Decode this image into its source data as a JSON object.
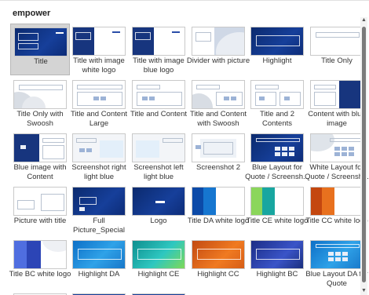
{
  "gallery": {
    "header": "empower",
    "rows": [
      [
        {
          "label": "Title",
          "theme": "dark",
          "selected": true
        },
        {
          "label": "Title with image white logo",
          "theme": "white-img"
        },
        {
          "label": "Title with image blue logo",
          "theme": "white-img"
        },
        {
          "label": "Divider with picture",
          "theme": "divider"
        },
        {
          "label": "Highlight",
          "theme": "dark-hl"
        },
        {
          "label": "Title Only",
          "theme": "white-title"
        }
      ],
      [
        {
          "label": "Title Only with Swoosh",
          "theme": "swoosh"
        },
        {
          "label": "Title and Content Large",
          "theme": "content-large"
        },
        {
          "label": "Title and Content",
          "theme": "content"
        },
        {
          "label": "Title and Content with Swoosh",
          "theme": "content-swoosh"
        },
        {
          "label": "Title and 2 Contents",
          "theme": "two-content"
        },
        {
          "label": "Content with blue image",
          "theme": "content-blue"
        }
      ],
      [
        {
          "label": "Blue image with Content",
          "theme": "blue-content"
        },
        {
          "label": "Screenshot right light blue",
          "theme": "shot-right"
        },
        {
          "label": "Screenshot left light blue",
          "theme": "shot-left"
        },
        {
          "label": "Screenshot 2",
          "theme": "shot2"
        },
        {
          "label": "Blue Layout for Quote / Screensh...",
          "theme": "quote-blue"
        },
        {
          "label": "White Layout for Quote / Screensh...",
          "theme": "quote-white"
        }
      ],
      [
        {
          "label": "Picture with title",
          "theme": "picture"
        },
        {
          "label": "Full Picture_Special",
          "theme": "full-pic"
        },
        {
          "label": "Logo",
          "theme": "logo"
        },
        {
          "label": "Title DA white logo",
          "theme": "da"
        },
        {
          "label": "Title CE white logo",
          "theme": "ce"
        },
        {
          "label": "Title CC white logo",
          "theme": "cc"
        }
      ],
      [
        {
          "label": "Title BC white logo",
          "theme": "bc"
        },
        {
          "label": "Highlight DA",
          "theme": "hl-da"
        },
        {
          "label": "Highlight CE",
          "theme": "hl-ce"
        },
        {
          "label": "Highlight CC",
          "theme": "hl-cc"
        },
        {
          "label": "Highlight BC",
          "theme": "hl-bc"
        },
        {
          "label": "Blue Layout DA for Quote",
          "theme": "quote-da"
        }
      ]
    ]
  },
  "scrollbar": {
    "up_icon": "▲",
    "down_icon": "▼"
  },
  "colors": {
    "accent_dark": "#0b2a6e",
    "selection": "#d4d4d4"
  }
}
